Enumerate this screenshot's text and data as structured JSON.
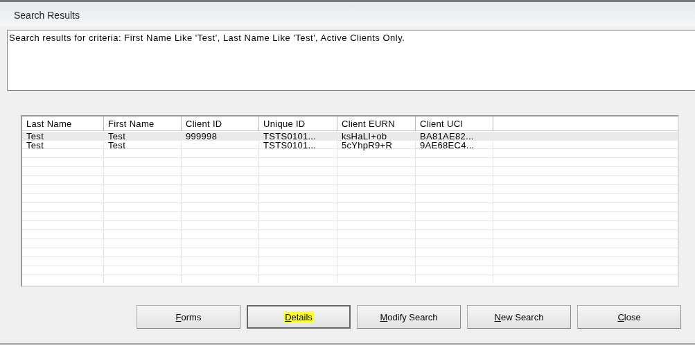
{
  "window": {
    "title": "Search Results"
  },
  "criteria": "Search results for criteria:  First Name Like 'Test',  Last Name Like 'Test', Active Clients Only.",
  "table": {
    "columns": [
      "Last Name",
      "First Name",
      "Client ID",
      "Unique ID",
      "Client EURN",
      "Client UCI"
    ],
    "rows": [
      {
        "cells": [
          "Test",
          "Test",
          "999998",
          "TSTS0101...",
          "ksHaLI+ob",
          "BA81AE82..."
        ],
        "selected": true
      },
      {
        "cells": [
          "Test",
          "Test",
          "",
          "TSTS0101...",
          "5cYhpR9+R",
          "9AE68EC4..."
        ],
        "selected": false
      }
    ]
  },
  "buttons": [
    {
      "label": "Forms",
      "highlighted": false
    },
    {
      "label": "Details",
      "highlighted": true
    },
    {
      "label": "Modify Search",
      "highlighted": false
    },
    {
      "label": "New Search",
      "highlighted": false
    },
    {
      "label": "Close",
      "highlighted": false
    }
  ]
}
